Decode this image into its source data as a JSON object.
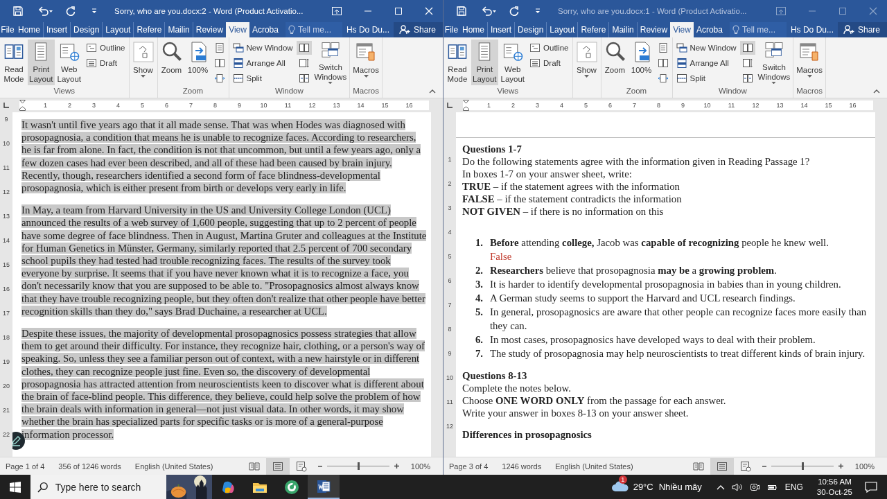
{
  "windows": [
    {
      "title": "Sorry, who are you.docx:2 - Word (Product Activatio...",
      "active": true,
      "tabs": [
        {
          "label": "File",
          "selected": false
        },
        {
          "label": "Home",
          "selected": false
        },
        {
          "label": "Insert",
          "selected": false
        },
        {
          "label": "Design",
          "selected": false
        },
        {
          "label": "Layout",
          "selected": false
        },
        {
          "label": "Refere",
          "selected": false
        },
        {
          "label": "Mailin",
          "selected": false
        },
        {
          "label": "Review",
          "selected": false
        },
        {
          "label": "View",
          "selected": true
        },
        {
          "label": "Acroba",
          "selected": false
        }
      ],
      "tell_me": {
        "placeholder": "Tell me..."
      },
      "user": "Hs Do Du...",
      "share": "Share",
      "ribbon": [
        {
          "label": "Views",
          "items": [
            {
              "kind": "read",
              "label": "Read Mode",
              "selected": false,
              "dropdown": false
            },
            {
              "kind": "print",
              "label": "Print Layout",
              "selected": true,
              "dropdown": false
            },
            {
              "kind": "web",
              "label": "Web Layout",
              "selected": false,
              "dropdown": false
            },
            {
              "kind": "stack",
              "buttons": [
                {
                  "kind": "outline",
                  "label": "Outline",
                  "selected": false
                },
                {
                  "kind": "draft",
                  "label": "Draft",
                  "selected": false
                }
              ]
            }
          ]
        },
        {
          "items": [
            {
              "kind": "show",
              "label": "Show",
              "selected": false,
              "dropdown": true
            }
          ]
        },
        {
          "label": "Zoom",
          "items": [
            {
              "kind": "zoom",
              "label": "Zoom",
              "selected": false,
              "dropdown": false
            },
            {
              "kind": "zoom100",
              "label": "100%",
              "selected": false,
              "dropdown": false
            },
            {
              "kind": "stack",
              "buttons": [
                {
                  "kind": "one-page",
                  "selected": false
                },
                {
                  "kind": "multiple-pages",
                  "selected": false
                },
                {
                  "kind": "page-width",
                  "selected": false
                }
              ]
            }
          ]
        },
        {
          "label": "Window",
          "items": [
            {
              "kind": "stack",
              "buttons": [
                {
                  "kind": "new-window",
                  "label": "New Window",
                  "selected": false
                },
                {
                  "kind": "arrange-all",
                  "label": "Arrange All",
                  "selected": false
                },
                {
                  "kind": "split",
                  "label": "Split",
                  "selected": false
                }
              ]
            },
            {
              "kind": "stack",
              "buttons": [
                {
                  "kind": "side-by-side",
                  "selected": true
                },
                {
                  "kind": "sync-scroll",
                  "selected": false
                },
                {
                  "kind": "reset-position",
                  "selected": false
                }
              ]
            },
            {
              "kind": "switch",
              "label": "Switch Windows",
              "selected": false,
              "dropdown": true
            }
          ]
        },
        {
          "label": "Macros",
          "items": [
            {
              "kind": "macros",
              "label": "Macros",
              "selected": false,
              "dropdown": true
            }
          ]
        }
      ],
      "ruler": [
        "1",
        "2",
        "3",
        "4",
        "5",
        "6",
        "7",
        "8",
        "9",
        "10",
        "11",
        "12",
        "13",
        "14",
        "15",
        "16"
      ],
      "vertical_ruler": [
        "9",
        "10",
        "11",
        "12",
        "13",
        "14",
        "15",
        "16",
        "17",
        "18",
        "19",
        "20",
        "21",
        "22"
      ],
      "document": {
        "kind": "passage",
        "selected": true,
        "pen_button": true,
        "paragraphs": [
          "It wasn't until five years ago that it all made sense. That was when Hodes was diagnosed with prosopagnosia, a condition that means he is unable to recognize faces. According to researchers, he is far from alone. In fact, the condition is not that uncommon, but until a few years ago, only a few dozen cases had ever been described, and all of these had been caused by brain injury. Recently, though, researchers identified a second form of face blindness-developmental prosopagnosia, which is either present from birth or develops very early in life.",
          "In May, a team from Harvard University in the US and University College London (UCL) announced the results of a web survey of 1,600 people, suggesting that up to 2 percent of people have some degree of face blindness. Then in August, Martina Gruter and colleagues at the Institute for Human Genetics in Münster, Germany, similarly reported that 2.5 percent of 700 secondary school pupils they had tested had trouble recognizing faces. The results of the survey took everyone by surprise. It seems that if you have never known what it is to recognize a face, you don't necessarily know that you are supposed to be able to. \"Prosopagnosics almost always know that they have trouble recognizing people, but they often don't realize that other people have better recognition skills than they do,\" says Brad Duchaine, a researcher at UCL.",
          "Despite these issues, the majority of developmental prosopagnosics possess strategies that allow them to get around their difficulty. For instance, they recognize hair, clothing, or a person's way of speaking. So, unless they see a familiar person out of context, with a new hairstyle or in different clothes, they can recognize people just fine. Even so, the discovery of developmental prosopagnosia has attracted attention from neuroscientists keen to discover what is different about the brain of face-blind people. This difference, they believe, could help solve the problem of how the brain deals with information in general—not just visual data. In other words, it may show whether the brain has specialized parts for specific tasks or is more of a general-purpose information processor."
        ]
      },
      "status": {
        "page": "Page 1 of 4",
        "words": "356 of 1246 words",
        "language": "English (United States)",
        "views": [
          {
            "kind": "read",
            "selected": false
          },
          {
            "kind": "print",
            "selected": true
          },
          {
            "kind": "web",
            "selected": false
          }
        ],
        "level": 0.5,
        "zoom": "100%"
      }
    },
    {
      "title": "Sorry, who are you.docx:1 - Word (Product Activatio...",
      "active": false,
      "tabs": [
        {
          "label": "File",
          "selected": false
        },
        {
          "label": "Home",
          "selected": false
        },
        {
          "label": "Insert",
          "selected": false
        },
        {
          "label": "Design",
          "selected": false
        },
        {
          "label": "Layout",
          "selected": false
        },
        {
          "label": "Refere",
          "selected": false
        },
        {
          "label": "Mailin",
          "selected": false
        },
        {
          "label": "Review",
          "selected": false
        },
        {
          "label": "View",
          "selected": true
        },
        {
          "label": "Acroba",
          "selected": false
        }
      ],
      "tell_me": {
        "placeholder": "Tell me..."
      },
      "user": "Hs Do Du...",
      "share": "Share",
      "ribbon": [
        {
          "label": "Views",
          "items": [
            {
              "kind": "read",
              "label": "Read Mode",
              "selected": false,
              "dropdown": false
            },
            {
              "kind": "print",
              "label": "Print Layout",
              "selected": true,
              "dropdown": false
            },
            {
              "kind": "web",
              "label": "Web Layout",
              "selected": false,
              "dropdown": false
            },
            {
              "kind": "stack",
              "buttons": [
                {
                  "kind": "outline",
                  "label": "Outline",
                  "selected": false
                },
                {
                  "kind": "draft",
                  "label": "Draft",
                  "selected": false
                }
              ]
            }
          ]
        },
        {
          "items": [
            {
              "kind": "show",
              "label": "Show",
              "selected": false,
              "dropdown": true
            }
          ]
        },
        {
          "label": "Zoom",
          "items": [
            {
              "kind": "zoom",
              "label": "Zoom",
              "selected": false,
              "dropdown": false
            },
            {
              "kind": "zoom100",
              "label": "100%",
              "selected": false,
              "dropdown": false
            },
            {
              "kind": "stack",
              "buttons": [
                {
                  "kind": "one-page",
                  "selected": false
                },
                {
                  "kind": "multiple-pages",
                  "selected": false
                },
                {
                  "kind": "page-width",
                  "selected": false
                }
              ]
            }
          ]
        },
        {
          "label": "Window",
          "items": [
            {
              "kind": "stack",
              "buttons": [
                {
                  "kind": "new-window",
                  "label": "New Window",
                  "selected": false
                },
                {
                  "kind": "arrange-all",
                  "label": "Arrange All",
                  "selected": false
                },
                {
                  "kind": "split",
                  "label": "Split",
                  "selected": false
                }
              ]
            },
            {
              "kind": "stack",
              "buttons": [
                {
                  "kind": "side-by-side",
                  "selected": true
                },
                {
                  "kind": "sync-scroll",
                  "selected": false
                },
                {
                  "kind": "reset-position",
                  "selected": false
                }
              ]
            },
            {
              "kind": "switch",
              "label": "Switch Windows",
              "selected": false,
              "dropdown": true
            }
          ]
        },
        {
          "label": "Macros",
          "items": [
            {
              "kind": "macros",
              "label": "Macros",
              "selected": false,
              "dropdown": true
            }
          ]
        }
      ],
      "ruler": [
        "1",
        "2",
        "3",
        "4",
        "5",
        "6",
        "7",
        "8",
        "9",
        "10",
        "11",
        "12",
        "13",
        "14",
        "15",
        "16"
      ],
      "vertical_ruler": [
        "1",
        "2",
        "3",
        "4",
        "5",
        "6",
        "7",
        "8",
        "9",
        "10",
        "11",
        "12"
      ],
      "document": {
        "kind": "questions",
        "sections": [
          {
            "heading": "Questions 1-7",
            "lines": [
              "Do the following statements agree with the information given in Reading Passage 1?",
              "In boxes 1-7 on your answer sheet, write:",
              "**TRUE** – if the statement agrees with the information",
              "**FALSE** – if the statement contradicts the information",
              "**NOT GIVEN** – if there is no information on this"
            ],
            "items": [
              {
                "number": "1.",
                "text": "**Before** attending **college,** Jacob was **capable of recognizing** people he knew well.",
                "answer": "False"
              },
              {
                "number": "2.",
                "text": "**Researchers** believe that prosopagnosia **may be** a **growing problem**."
              },
              {
                "number": "3.",
                "text": "It is harder to identify developmental prosopagnosia in babies than in young children."
              },
              {
                "number": "4.",
                "text": "A German study seems to support the Harvard and UCL research findings."
              },
              {
                "number": "5.",
                "text": "In general, prosopagnosics are aware that other people can recognize faces more easily than they can."
              },
              {
                "number": "6.",
                "text": "In most cases, prosopagnosics have developed ways to deal with their problem."
              },
              {
                "number": "7.",
                "text": "The study of prosopagnosia may help neuroscientists to treat different kinds of brain injury."
              }
            ]
          },
          {
            "heading": "Questions 8-13",
            "lines": [
              "Complete the notes below.",
              "Choose **ONE WORD ONLY** from the passage for each answer.",
              "Write your answer in boxes 8-13 on your answer sheet."
            ]
          },
          {
            "heading": "Differences in prosopagnosics"
          }
        ]
      },
      "status": {
        "page": "Page 3 of 4",
        "words": "1246 words",
        "language": "English (United States)",
        "views": [
          {
            "kind": "read",
            "selected": false
          },
          {
            "kind": "print",
            "selected": true
          },
          {
            "kind": "web",
            "selected": false
          }
        ],
        "level": 0.5,
        "zoom": "100%"
      }
    }
  ],
  "taskbar": {
    "search": {
      "placeholder": "Type here to search"
    },
    "apps": [
      {
        "kind": "copilot",
        "selected": false
      },
      {
        "kind": "explorer",
        "selected": false
      },
      {
        "kind": "green",
        "selected": false
      },
      {
        "kind": "word",
        "selected": true
      }
    ],
    "weather": {
      "badge": "1",
      "temperature": "29°C",
      "condition": "Nhiều mây"
    },
    "language": "ENG",
    "time": "10:56 AM",
    "date": "30-Oct-25"
  }
}
